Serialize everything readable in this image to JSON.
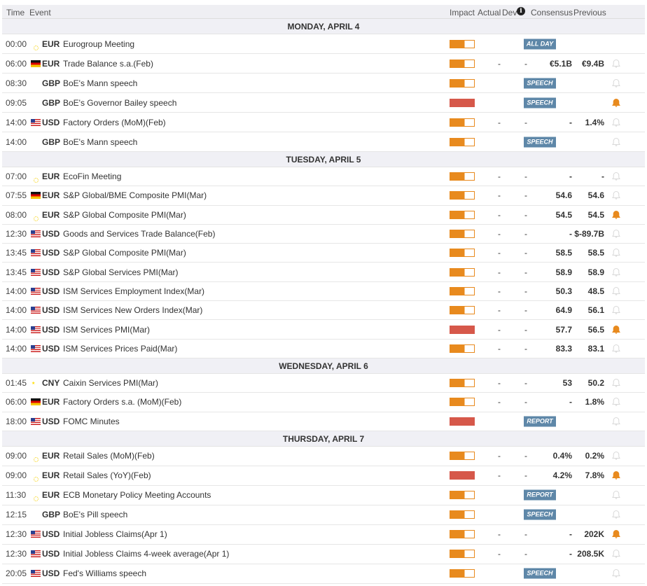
{
  "header": {
    "time": "Time",
    "event": "Event",
    "impact": "Impact",
    "actual": "Actual",
    "dev": "Dev",
    "consensus": "Consensus",
    "previous": "Previous"
  },
  "colors": {
    "medium": "#e88a1e",
    "high": "#d6584a",
    "badge": "#5e87a8",
    "bell_on": "#e88a1e",
    "bell_off": "#d9d9d9"
  },
  "days": [
    {
      "label": "MONDAY, APRIL 4",
      "rows": [
        [
          "00:00",
          "eu",
          "EUR",
          "Eurogroup Meeting",
          "medium",
          "",
          "",
          "",
          "",
          "ALL DAY",
          "none"
        ],
        [
          "06:00",
          "de",
          "EUR",
          "Trade Balance s.a.(Feb)",
          "medium",
          "-",
          "-",
          "€5.1B",
          "€9.4B",
          "",
          "off"
        ],
        [
          "08:30",
          "gb",
          "GBP",
          "BoE's Mann speech",
          "medium",
          "",
          "",
          "",
          "",
          "SPEECH",
          "off"
        ],
        [
          "09:05",
          "gb",
          "GBP",
          "BoE's Governor Bailey speech",
          "high",
          "",
          "",
          "",
          "",
          "SPEECH",
          "on"
        ],
        [
          "14:00",
          "us",
          "USD",
          "Factory Orders (MoM)(Feb)",
          "medium",
          "-",
          "-",
          "-",
          "1.4%",
          "",
          "off"
        ],
        [
          "14:00",
          "gb",
          "GBP",
          "BoE's Mann speech",
          "medium",
          "",
          "",
          "",
          "",
          "SPEECH",
          "off"
        ]
      ]
    },
    {
      "label": "TUESDAY, APRIL 5",
      "rows": [
        [
          "07:00",
          "eu",
          "EUR",
          "EcoFin Meeting",
          "medium",
          "-",
          "-",
          "-",
          "-",
          "",
          "off"
        ],
        [
          "07:55",
          "de",
          "EUR",
          "S&P Global/BME Composite PMI(Mar)",
          "medium",
          "-",
          "-",
          "54.6",
          "54.6",
          "",
          "off"
        ],
        [
          "08:00",
          "eu",
          "EUR",
          "S&P Global Composite PMI(Mar)",
          "medium",
          "-",
          "-",
          "54.5",
          "54.5",
          "",
          "on"
        ],
        [
          "12:30",
          "us",
          "USD",
          "Goods and Services Trade Balance(Feb)",
          "medium",
          "-",
          "-",
          "-",
          "$-89.7B",
          "",
          "off"
        ],
        [
          "13:45",
          "us",
          "USD",
          "S&P Global Composite PMI(Mar)",
          "medium",
          "-",
          "-",
          "58.5",
          "58.5",
          "",
          "off"
        ],
        [
          "13:45",
          "us",
          "USD",
          "S&P Global Services PMI(Mar)",
          "medium",
          "-",
          "-",
          "58.9",
          "58.9",
          "",
          "off"
        ],
        [
          "14:00",
          "us",
          "USD",
          "ISM Services Employment Index(Mar)",
          "medium",
          "-",
          "-",
          "50.3",
          "48.5",
          "",
          "off"
        ],
        [
          "14:00",
          "us",
          "USD",
          "ISM Services New Orders Index(Mar)",
          "medium",
          "-",
          "-",
          "64.9",
          "56.1",
          "",
          "off"
        ],
        [
          "14:00",
          "us",
          "USD",
          "ISM Services PMI(Mar)",
          "high",
          "-",
          "-",
          "57.7",
          "56.5",
          "",
          "on"
        ],
        [
          "14:00",
          "us",
          "USD",
          "ISM Services Prices Paid(Mar)",
          "medium",
          "-",
          "-",
          "83.3",
          "83.1",
          "",
          "off"
        ]
      ]
    },
    {
      "label": "WEDNESDAY, APRIL 6",
      "rows": [
        [
          "01:45",
          "cn",
          "CNY",
          "Caixin Services PMI(Mar)",
          "medium",
          "-",
          "-",
          "53",
          "50.2",
          "",
          "off"
        ],
        [
          "06:00",
          "de",
          "EUR",
          "Factory Orders s.a. (MoM)(Feb)",
          "medium",
          "-",
          "-",
          "-",
          "1.8%",
          "",
          "off"
        ],
        [
          "18:00",
          "us",
          "USD",
          "FOMC Minutes",
          "high",
          "",
          "",
          "",
          "",
          "REPORT",
          "off"
        ]
      ]
    },
    {
      "label": "THURSDAY, APRIL 7",
      "rows": [
        [
          "09:00",
          "eu",
          "EUR",
          "Retail Sales (MoM)(Feb)",
          "medium",
          "-",
          "-",
          "0.4%",
          "0.2%",
          "",
          "off"
        ],
        [
          "09:00",
          "eu",
          "EUR",
          "Retail Sales (YoY)(Feb)",
          "high",
          "-",
          "-",
          "4.2%",
          "7.8%",
          "",
          "on"
        ],
        [
          "11:30",
          "eu",
          "EUR",
          "ECB Monetary Policy Meeting Accounts",
          "medium",
          "",
          "",
          "",
          "",
          "REPORT",
          "off"
        ],
        [
          "12:15",
          "gb",
          "GBP",
          "BoE's Pill speech",
          "medium",
          "",
          "",
          "",
          "",
          "SPEECH",
          "off"
        ],
        [
          "12:30",
          "us",
          "USD",
          "Initial Jobless Claims(Apr 1)",
          "medium",
          "-",
          "-",
          "-",
          "202K",
          "",
          "on"
        ],
        [
          "12:30",
          "us",
          "USD",
          "Initial Jobless Claims 4-week average(Apr 1)",
          "medium",
          "-",
          "-",
          "-",
          "208.5K",
          "",
          "off"
        ],
        [
          "20:05",
          "us",
          "USD",
          "Fed's Williams speech",
          "medium",
          "",
          "",
          "",
          "",
          "SPEECH",
          "off"
        ]
      ]
    }
  ]
}
